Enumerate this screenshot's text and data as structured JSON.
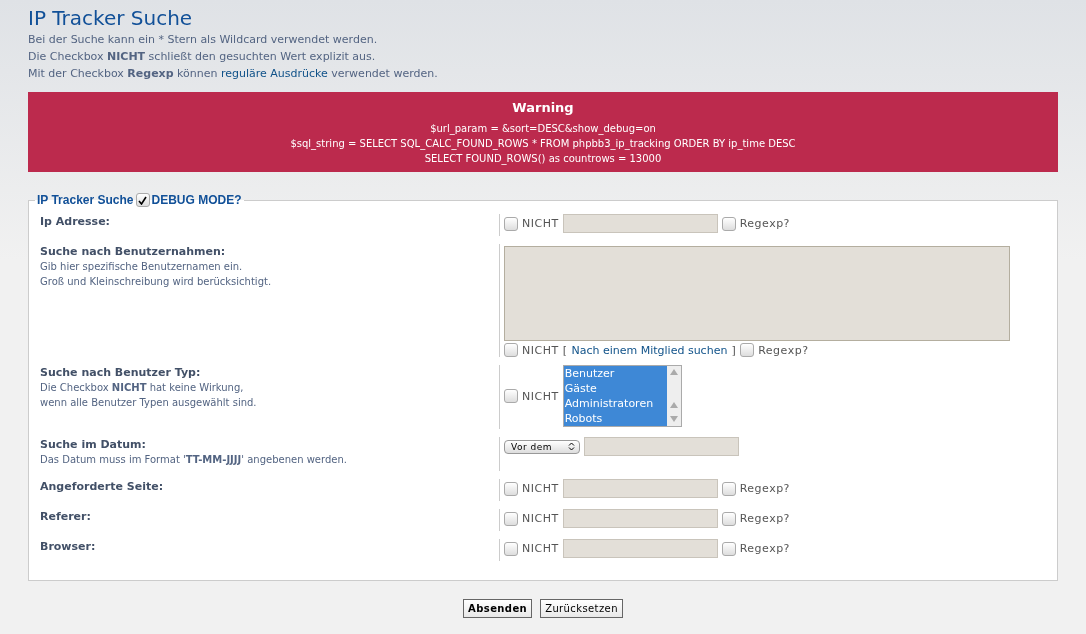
{
  "title": "IP Tracker Suche",
  "intro": [
    {
      "text": "Bei der Suche kann ein * Stern als Wildcard verwendet werden."
    },
    {
      "text": "Die Checkbox **NICHT** schließt den gesuchten Wert explizit aus."
    },
    {
      "text": "Mit der Checkbox **Regexp** können",
      "link": "reguläre Ausdrücke",
      "after": "verwendet werden."
    }
  ],
  "warning": {
    "title": "Warning",
    "lines": [
      "$url_param = &sort=DESC&show_debug=on",
      "$sql_string = SELECT SQL_CALC_FOUND_ROWS * FROM phpbb3_ip_tracking ORDER BY ip_time DESC",
      "SELECT FOUND_ROWS() as countrows = 13000"
    ]
  },
  "legend": {
    "title": "IP Tracker Suche",
    "debug_label": "DEBUG MODE?",
    "debug_checked": true
  },
  "fields": [
    {
      "kind": "text",
      "label": "Ip Adresse:",
      "not_label": "NICHT",
      "not_checked": false,
      "regexp_label": "Regexp?",
      "regexp_checked": false
    },
    {
      "kind": "textarea",
      "label": "Suche nach Benutzernahmen:",
      "description": [
        "Gib hier spezifische Benutzernamen ein.",
        "Groß und Kleinschreibung wird berücksichtigt."
      ],
      "not_label": "NICHT",
      "not_checked": false,
      "link_open": "[",
      "link": "Nach einem Mitglied suchen",
      "link_close": "]",
      "regexp_label": "Regexp?",
      "regexp_checked": false
    },
    {
      "kind": "select",
      "label": "Suche nach Benutzer Typ:",
      "description": [
        "Die Checkbox **NICHT** hat keine Wirkung,",
        "wenn alle Benutzer Typen ausgewählt sind."
      ],
      "not_label": "NICHT",
      "not_checked": false,
      "options": [
        {
          "label": "Benutzer",
          "selected": true
        },
        {
          "label": "Gäste",
          "selected": true
        },
        {
          "label": "Administratoren",
          "selected": true
        },
        {
          "label": "Robots",
          "selected": true
        }
      ]
    },
    {
      "kind": "date",
      "label": "Suche im Datum:",
      "description": [
        "Das Datum muss im Format '**TT-MM-JJJJ**' angebenen werden."
      ],
      "date_mode": "Vor dem"
    },
    {
      "kind": "text",
      "label": "Angeforderte Seite:",
      "not_label": "NICHT",
      "not_checked": false,
      "regexp_label": "Regexp?",
      "regexp_checked": false
    },
    {
      "kind": "text",
      "label": "Referer:",
      "not_label": "NICHT",
      "not_checked": false,
      "regexp_label": "Regexp?",
      "regexp_checked": false
    },
    {
      "kind": "text",
      "label": "Browser:",
      "not_label": "NICHT",
      "not_checked": false,
      "regexp_label": "Regexp?",
      "regexp_checked": false
    }
  ],
  "buttons": [
    {
      "label": "Absenden",
      "primary": true
    },
    {
      "label": "Zurücksetzen",
      "primary": false
    }
  ]
}
